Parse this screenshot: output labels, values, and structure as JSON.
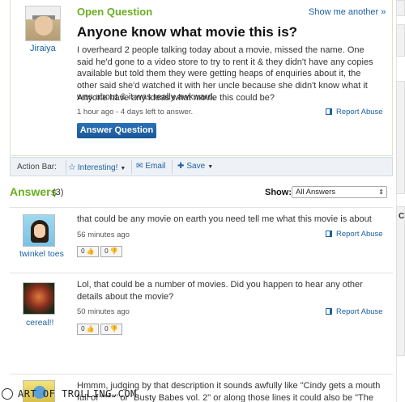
{
  "question": {
    "status": "Open Question",
    "show_another": "Show me another »",
    "asker": "Jiraiya",
    "title": "Anyone know what movie this is?",
    "body": "I overheard 2 people talking today about a movie, missed the name. One said he'd gone to a video store to try to rent it & they didn't have any copies available but told them they were getting heaps of enquiries about it, the other said she'd watched it with her uncle because she didn't know what it was about & it was really awkward.",
    "body2": "Anyone have any ideas what movie this could be?",
    "meta": "1 hour ago - 4 days left to answer.",
    "report": "Report Abuse",
    "answer_button": "Answer Question"
  },
  "action_bar": {
    "label": "Action Bar:",
    "interesting": "Interesting!",
    "email": "Email",
    "save": "Save"
  },
  "answers": {
    "heading": "Answers",
    "count": "(3)",
    "show_label": "Show:",
    "show_value": "All Answers",
    "items": [
      {
        "user": "twinkel toes",
        "text": "that could be any movie on earth you need tell me what this movie is about",
        "meta": "56 minutes ago",
        "report": "Report Abuse",
        "up": "0",
        "down": "0"
      },
      {
        "user": "cereal!!",
        "text": "Lol, that could be a number of movies. Did you happen to hear any other details about the movie?",
        "meta": "50 minutes ago",
        "report": "Report Abuse",
        "up": "0",
        "down": "0"
      },
      {
        "user": "",
        "text": "Hmmm, judging by that description it sounds awfully like \"Cindy gets a mouth full of ****\" or \"Busty Babes vol. 2\" or along those lines it could also be \"The Notebook\""
      }
    ]
  },
  "right_edge": {
    "letter": "C"
  },
  "watermark": "ART OF TROLLING.COM",
  "icons": [
    "flag-icon",
    "star-icon",
    "email-icon",
    "save-icon",
    "thumbs-up-icon",
    "thumbs-down-icon"
  ],
  "colors": {
    "green": "#6aae20",
    "link": "#1d5fa0",
    "button": "#1a5897"
  }
}
